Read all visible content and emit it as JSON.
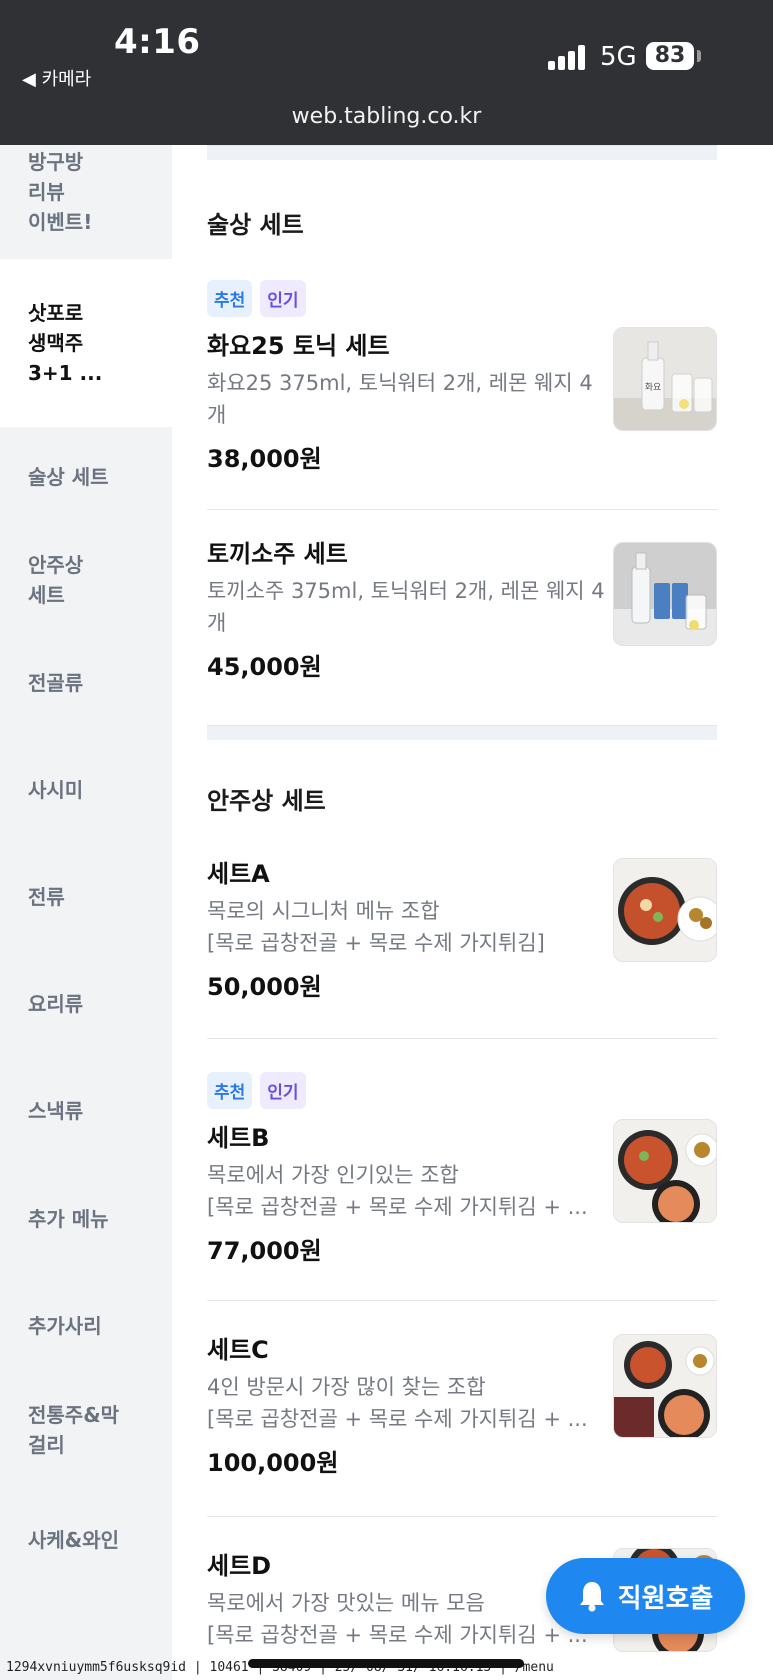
{
  "status_bar": {
    "time": "4:16",
    "back_label": "◀ 카메라",
    "network": "5G",
    "battery": "83",
    "url": "web.tabling.co.kr"
  },
  "sidebar": {
    "items": [
      {
        "label": "방구방\n리뷰\n이벤트!"
      },
      {
        "label": "삿포로\n생맥주\n3+1 ...",
        "active": true
      },
      {
        "label": "술상 세트"
      },
      {
        "label": "안주상\n세트"
      },
      {
        "label": "전골류"
      },
      {
        "label": "사시미"
      },
      {
        "label": "전류"
      },
      {
        "label": "요리류"
      },
      {
        "label": "스낵류"
      },
      {
        "label": "추가 메뉴"
      },
      {
        "label": "추가사리"
      },
      {
        "label": "전통주&막\n걸리"
      },
      {
        "label": "사케&와인"
      }
    ]
  },
  "sections": [
    {
      "title": "술상 세트",
      "items": [
        {
          "badges": [
            "추천",
            "인기"
          ],
          "name": "화요25 토닉 세트",
          "desc": "화요25 375ml, 토닉워터 2개, 레몬 웨지 4개",
          "price": "38,000원"
        },
        {
          "badges": [],
          "name": "토끼소주 세트",
          "desc": "토끼소주 375ml, 토닉워터 2개, 레몬 웨지 4개",
          "price": "45,000원"
        }
      ]
    },
    {
      "title": "안주상 세트",
      "items": [
        {
          "badges": [],
          "name": "세트A",
          "desc": "목로의 시그니처 메뉴 조합\n[목로 곱창전골 + 목로 수제 가지튀김]",
          "price": "50,000원"
        },
        {
          "badges": [
            "추천",
            "인기"
          ],
          "name": "세트B",
          "desc": "목로에서 가장 인기있는 조합\n[목로 곱창전골 + 목로 수제 가지튀김 + ...",
          "price": "77,000원"
        },
        {
          "badges": [],
          "name": "세트C",
          "desc": "4인 방문시 가장 많이 찾는 조합\n[목로 곱창전골 + 목로 수제 가지튀김 + ...",
          "price": "100,000원"
        },
        {
          "badges": [],
          "name": "세트D",
          "desc": "목로에서 가장 맛있는 메뉴 모음\n[목로 곱창전골 + 목로 수제 가지튀김 + ...",
          "price": ""
        }
      ]
    }
  ],
  "call_button": {
    "label": "직원호출"
  },
  "debug_text": "1294xvniuymm5f6usksq9id | 10461 | 38409 | 25/ 08/ 31/ 16:16:13 | /menu",
  "colors": {
    "accent": "#1e88f0",
    "sidebar_bg": "#f1f3f5",
    "badge_rec": "#2a7ae2",
    "badge_pop": "#6b4ee0"
  }
}
